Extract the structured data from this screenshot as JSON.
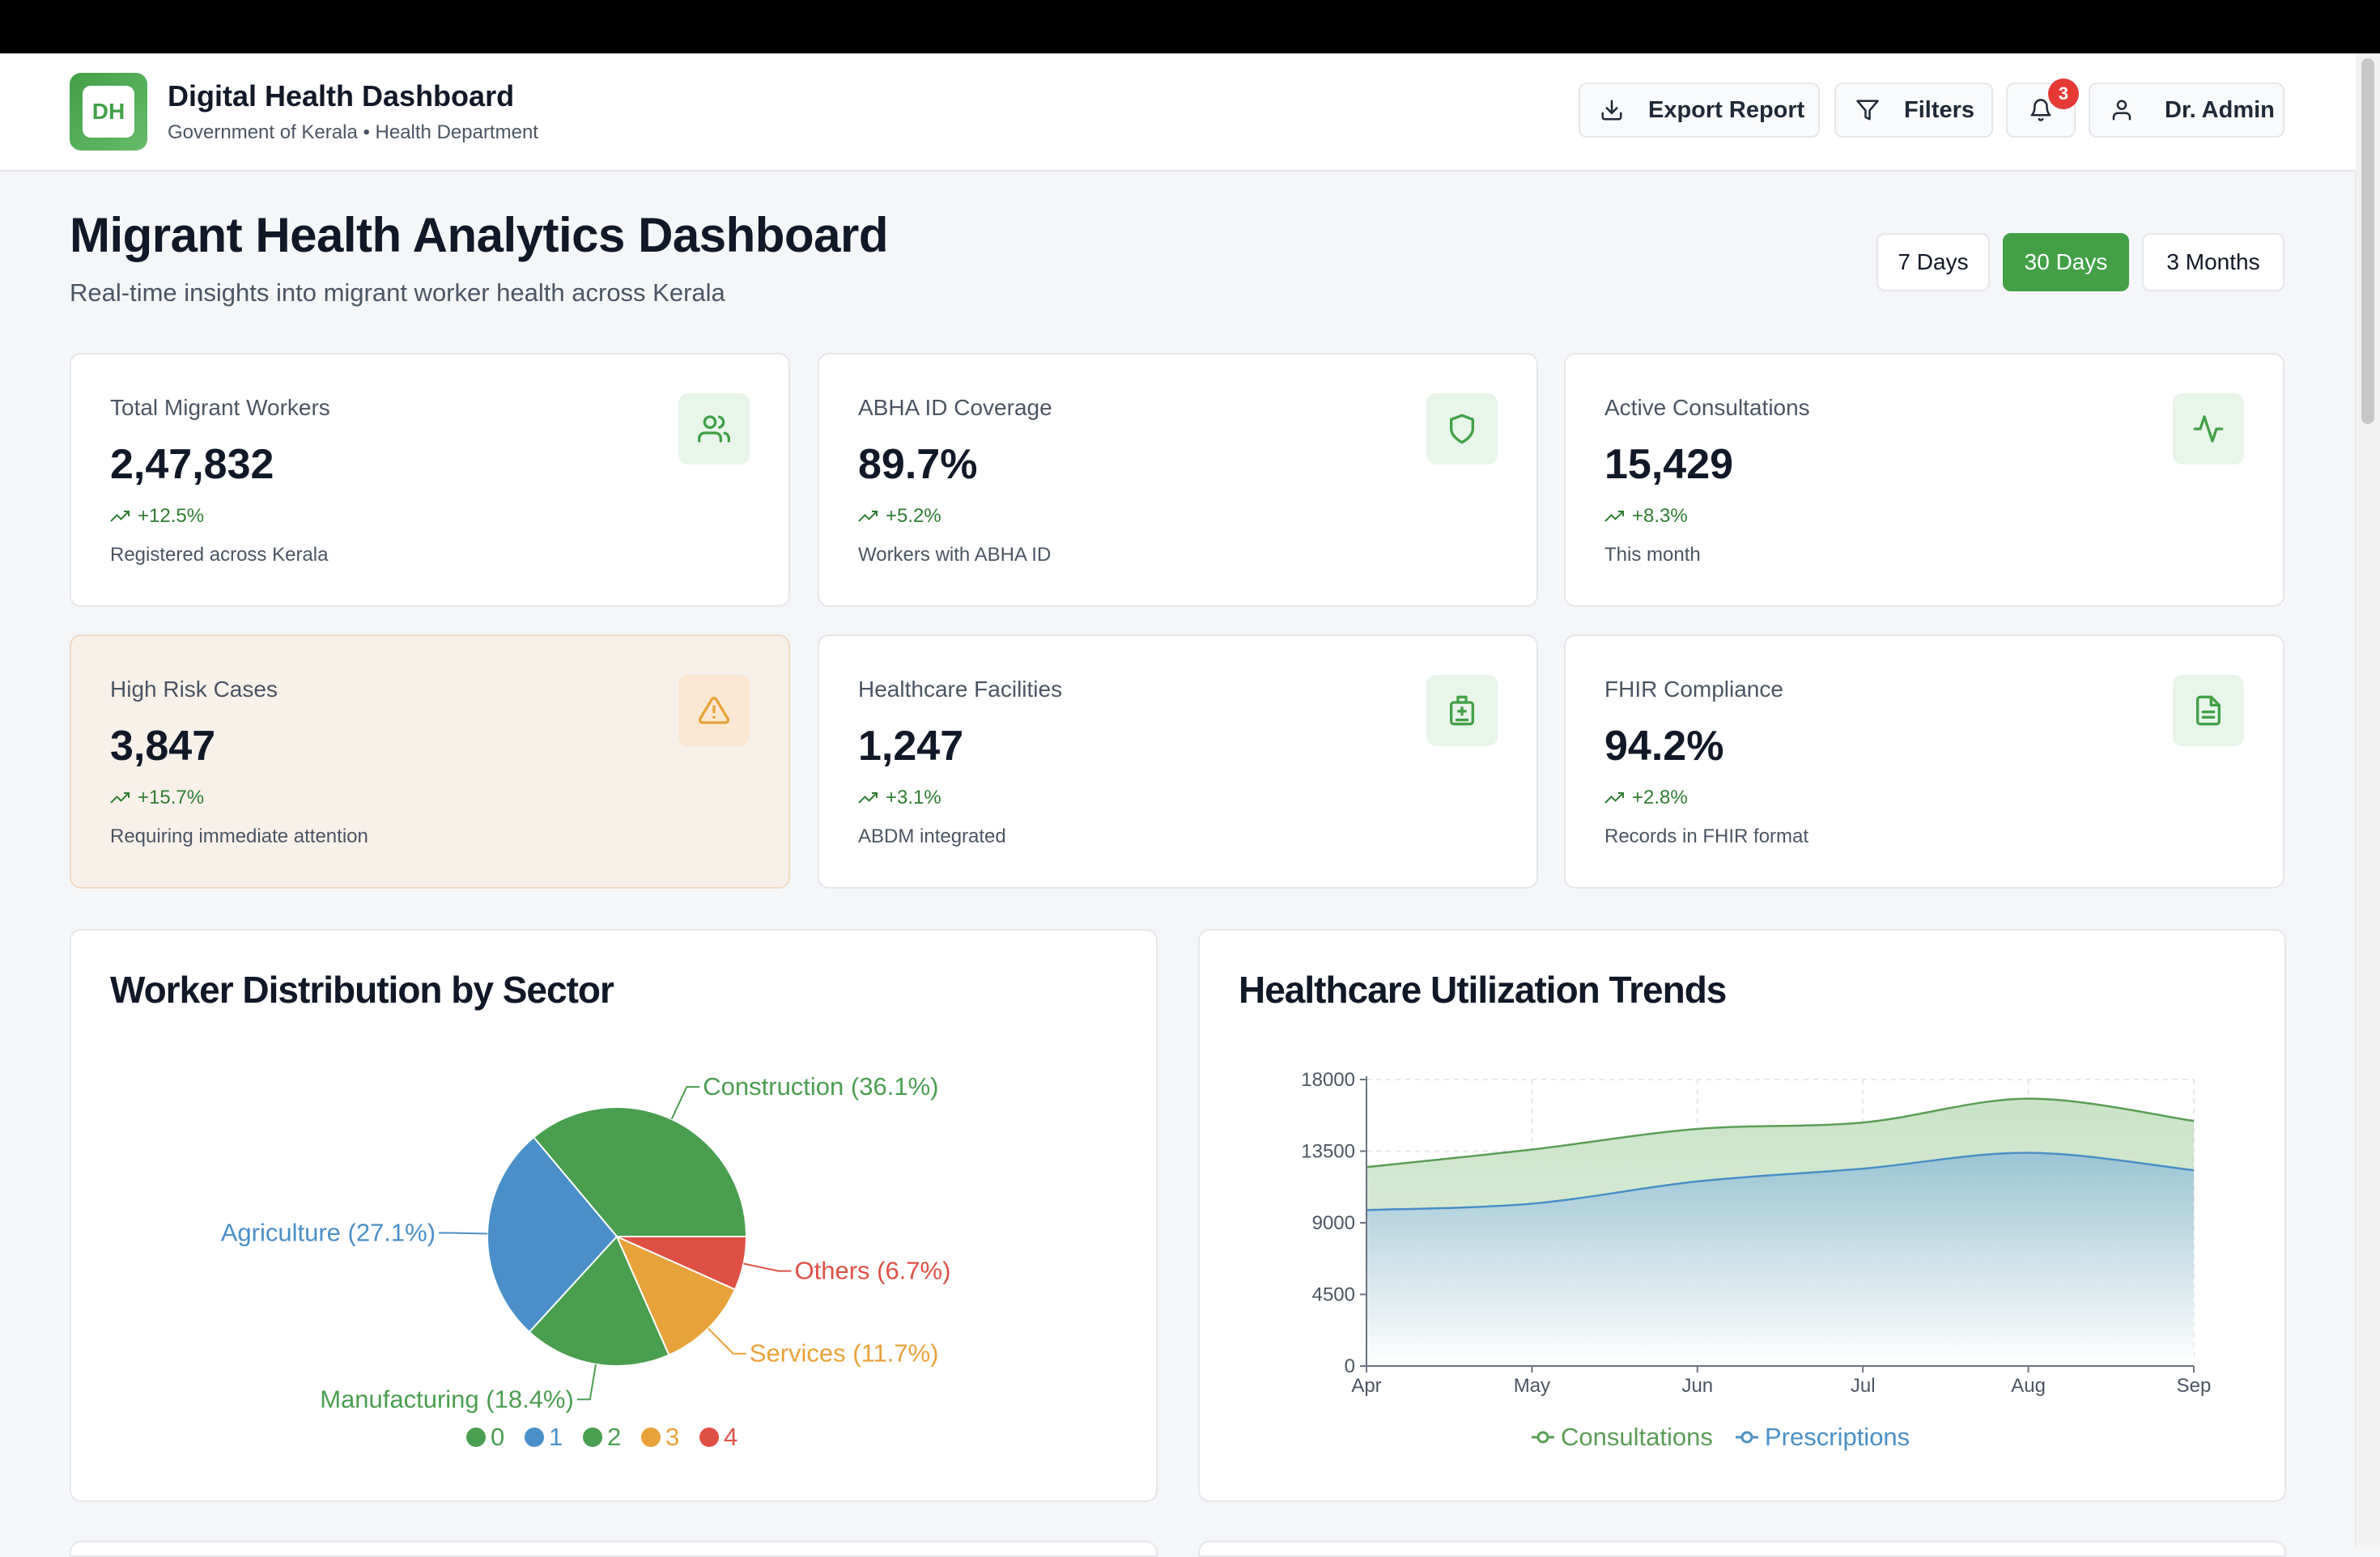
{
  "header": {
    "logo_text": "DH",
    "title": "Digital Health Dashboard",
    "subtitle": "Government of Kerala • Health Department",
    "export_label": "Export Report",
    "filters_label": "Filters",
    "notification_count": "3",
    "user_label": "Dr. Admin"
  },
  "page": {
    "title": "Migrant Health Analytics Dashboard",
    "subtitle": "Real-time insights into migrant worker health across Kerala",
    "ranges": [
      "7 Days",
      "30 Days",
      "3 Months"
    ],
    "active_range": "30 Days"
  },
  "stats": [
    {
      "label": "Total Migrant Workers",
      "value": "2,47,832",
      "delta": "+12.5%",
      "desc": "Registered across Kerala",
      "icon": "users-icon"
    },
    {
      "label": "ABHA ID Coverage",
      "value": "89.7%",
      "delta": "+5.2%",
      "desc": "Workers with ABHA ID",
      "icon": "shield-icon"
    },
    {
      "label": "Active Consultations",
      "value": "15,429",
      "delta": "+8.3%",
      "desc": "This month",
      "icon": "activity-icon"
    },
    {
      "label": "High Risk Cases",
      "value": "3,847",
      "delta": "+15.7%",
      "desc": "Requiring immediate attention",
      "icon": "alert-triangle-icon"
    },
    {
      "label": "Healthcare Facilities",
      "value": "1,247",
      "delta": "+3.1%",
      "desc": "ABDM integrated",
      "icon": "hospital-icon"
    },
    {
      "label": "FHIR Compliance",
      "value": "94.2%",
      "delta": "+2.8%",
      "desc": "Records in FHIR format",
      "icon": "file-text-icon"
    }
  ],
  "colors": {
    "accent": "#43a047",
    "warning": "#e8a23a",
    "danger": "#e53935",
    "consultations": "#5a9e55",
    "prescriptions": "#4a8fc6"
  },
  "chart_data": [
    {
      "type": "pie",
      "title": "Worker Distribution by Sector",
      "categories": [
        "Construction",
        "Agriculture",
        "Manufacturing",
        "Services",
        "Others"
      ],
      "values": [
        36.1,
        27.1,
        18.4,
        11.7,
        6.7
      ],
      "slice_labels": [
        "Construction (36.1%)",
        "Agriculture (27.1%)",
        "Manufacturing (18.4%)",
        "Services (11.7%)",
        "Others (6.7%)"
      ],
      "colors": [
        "#4a9e4f",
        "#4a8fc9",
        "#4a9e4f",
        "#e8a23a",
        "#de5045"
      ],
      "legend": [
        "0",
        "1",
        "2",
        "3",
        "4"
      ],
      "legend_position": "bottom"
    },
    {
      "type": "area",
      "title": "Healthcare Utilization Trends",
      "x": [
        "Apr",
        "May",
        "Jun",
        "Jul",
        "Aug",
        "Sep"
      ],
      "series": [
        {
          "name": "Consultations",
          "values": [
            12500,
            13600,
            14900,
            15300,
            16800,
            15400
          ]
        },
        {
          "name": "Prescriptions",
          "values": [
            9800,
            10200,
            11600,
            12400,
            13400,
            12300
          ]
        }
      ],
      "y_ticks": [
        "0",
        "4500",
        "9000",
        "13500",
        "18000"
      ],
      "ylim": [
        0,
        18000
      ],
      "grid": true,
      "legend_position": "bottom"
    }
  ]
}
